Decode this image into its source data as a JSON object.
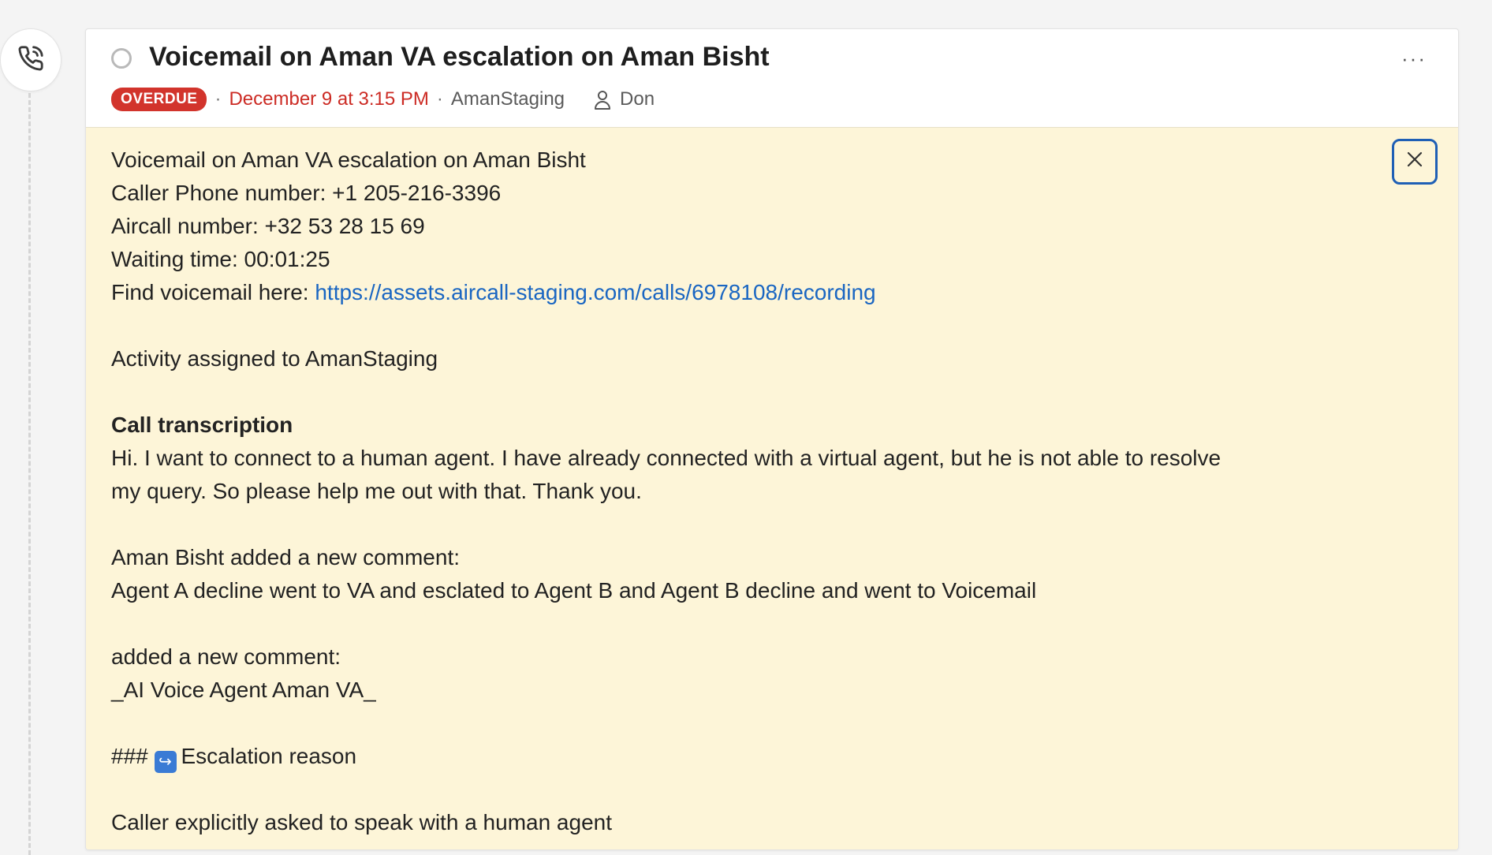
{
  "activity": {
    "title": "Voicemail on Aman VA escalation on Aman Bisht",
    "more_label": "···",
    "status_badge": "OVERDUE",
    "separator": "·",
    "due_date": "December 9 at 3:15 PM",
    "owner": "AmanStaging",
    "assignee": "Don",
    "icons": {
      "timeline": "phone-call-icon",
      "status": "circle-check-icon",
      "assignee": "user-icon",
      "close": "close-icon"
    },
    "colors": {
      "overdue_badge": "#d2342c",
      "due_text": "#cc2b24",
      "note_background": "#fdf5d8",
      "link": "#1a66c2",
      "close_border": "#1f5fb5"
    }
  },
  "note": {
    "line1": "Voicemail on Aman VA escalation on Aman Bisht",
    "line2": "Caller Phone number: +1 205-216-3396",
    "line3": "Aircall number: +32 53 28 15 69",
    "line4": "Waiting time: 00:01:25",
    "line5_prefix": "Find voicemail here: ",
    "line5_link": "https://assets.aircall-staging.com/calls/6978108/recording",
    "line6": "Activity assigned to AmanStaging",
    "transcription_heading": "Call transcription",
    "transcription_text": "Hi. I want to connect to a human agent. I have already connected with a virtual agent, but he is not able to resolve my query. So please help me out with that. Thank you.",
    "comment1_header": "Aman Bisht added a new comment:",
    "comment1_text": "Agent A decline went to VA and esclated to Agent B and Agent B decline and went to Voicemail",
    "comment2_header": "added a new comment:",
    "comment2_text": "_AI Voice Agent Aman VA_",
    "escalation_prefix": "###",
    "escalation_emoji": "↪",
    "escalation_label": "Escalation reason",
    "escalation_text": "Caller explicitly asked to speak with a human agent"
  }
}
